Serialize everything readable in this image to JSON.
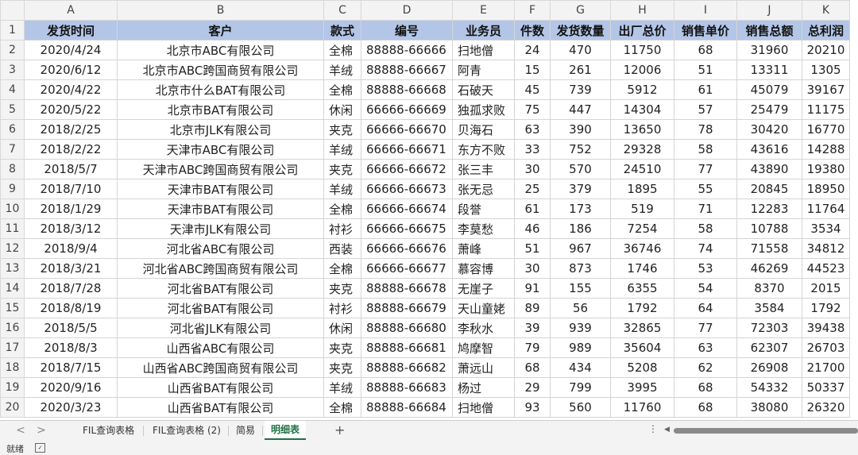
{
  "columns": [
    "A",
    "B",
    "C",
    "D",
    "E",
    "F",
    "G",
    "H",
    "I",
    "J",
    "K"
  ],
  "headers": [
    "发货时间",
    "客户",
    "款式",
    "编号",
    "业务员",
    "件数",
    "发货数量",
    "出厂总价",
    "销售单价",
    "销售总额",
    "总利润"
  ],
  "row_numbers": [
    "1",
    "2",
    "3",
    "4",
    "5",
    "6",
    "7",
    "8",
    "9",
    "10",
    "11",
    "12",
    "13",
    "14",
    "15",
    "16",
    "17",
    "18",
    "19",
    "20"
  ],
  "rows": [
    [
      "2020/4/24",
      "北京市ABC有限公司",
      "全棉",
      "88888-66666",
      "扫地僧",
      "24",
      "470",
      "11750",
      "68",
      "31960",
      "20210"
    ],
    [
      "2020/6/12",
      "北京市ABC跨国商贸有限公司",
      "羊绒",
      "88888-66667",
      "阿青",
      "15",
      "261",
      "12006",
      "51",
      "13311",
      "1305"
    ],
    [
      "2020/4/22",
      "北京市什么BAT有限公司",
      "全棉",
      "88888-66668",
      "石破天",
      "45",
      "739",
      "5912",
      "61",
      "45079",
      "39167"
    ],
    [
      "2020/5/22",
      "北京市BAT有限公司",
      "休闲",
      "66666-66669",
      "独孤求败",
      "75",
      "447",
      "14304",
      "57",
      "25479",
      "11175"
    ],
    [
      "2018/2/25",
      "北京市JLK有限公司",
      "夹克",
      "66666-66670",
      "贝海石",
      "63",
      "390",
      "13650",
      "78",
      "30420",
      "16770"
    ],
    [
      "2018/2/22",
      "天津市ABC有限公司",
      "羊绒",
      "66666-66671",
      "东方不败",
      "33",
      "752",
      "29328",
      "58",
      "43616",
      "14288"
    ],
    [
      "2018/5/7",
      "天津市ABC跨国商贸有限公司",
      "夹克",
      "66666-66672",
      "张三丰",
      "30",
      "570",
      "24510",
      "77",
      "43890",
      "19380"
    ],
    [
      "2018/7/10",
      "天津市BAT有限公司",
      "羊绒",
      "66666-66673",
      "张无忌",
      "25",
      "379",
      "1895",
      "55",
      "20845",
      "18950"
    ],
    [
      "2018/1/29",
      "天津市BAT有限公司",
      "全棉",
      "66666-66674",
      "段誉",
      "61",
      "173",
      "519",
      "71",
      "12283",
      "11764"
    ],
    [
      "2018/3/12",
      "天津市JLK有限公司",
      "衬衫",
      "66666-66675",
      "李莫愁",
      "46",
      "186",
      "7254",
      "58",
      "10788",
      "3534"
    ],
    [
      "2018/9/4",
      "河北省ABC有限公司",
      "西装",
      "66666-66676",
      "萧峰",
      "51",
      "967",
      "36746",
      "74",
      "71558",
      "34812"
    ],
    [
      "2018/3/21",
      "河北省ABC跨国商贸有限公司",
      "全棉",
      "66666-66677",
      "慕容博",
      "30",
      "873",
      "1746",
      "53",
      "46269",
      "44523"
    ],
    [
      "2018/7/28",
      "河北省BAT有限公司",
      "夹克",
      "88888-66678",
      "无崖子",
      "91",
      "155",
      "6355",
      "54",
      "8370",
      "2015"
    ],
    [
      "2018/8/19",
      "河北省BAT有限公司",
      "衬衫",
      "88888-66679",
      "天山童姥",
      "89",
      "56",
      "1792",
      "64",
      "3584",
      "1792"
    ],
    [
      "2018/5/5",
      "河北省JLK有限公司",
      "休闲",
      "88888-66680",
      "李秋水",
      "39",
      "939",
      "32865",
      "77",
      "72303",
      "39438"
    ],
    [
      "2018/8/3",
      "山西省ABC有限公司",
      "夹克",
      "88888-66681",
      "鸠摩智",
      "79",
      "989",
      "35604",
      "63",
      "62307",
      "26703"
    ],
    [
      "2018/7/15",
      "山西省ABC跨国商贸有限公司",
      "夹克",
      "88888-66682",
      "萧远山",
      "68",
      "434",
      "5208",
      "62",
      "26908",
      "21700"
    ],
    [
      "2020/9/16",
      "山西省BAT有限公司",
      "羊绒",
      "88888-66683",
      "杨过",
      "29",
      "799",
      "3995",
      "68",
      "54332",
      "50337"
    ],
    [
      "2020/3/23",
      "山西省BAT有限公司",
      "全棉",
      "88888-66684",
      "扫地僧",
      "93",
      "560",
      "11760",
      "68",
      "38080",
      "26320"
    ]
  ],
  "sheet_tabs": [
    {
      "label": "FIL查询表格",
      "active": false
    },
    {
      "label": "FIL查询表格 (2)",
      "active": false
    },
    {
      "label": "简易",
      "active": false
    },
    {
      "label": "明细表",
      "active": true
    }
  ],
  "tab_nav": {
    "prev": "<",
    "next": ">",
    "add": "+",
    "more": "⋮",
    "scroll_left": "◀"
  },
  "status": {
    "ready": "就绪"
  },
  "colors": {
    "header_fill": "#b4c6e7",
    "active_tab": "#1e7145",
    "gridline": "#d4d4d4"
  }
}
